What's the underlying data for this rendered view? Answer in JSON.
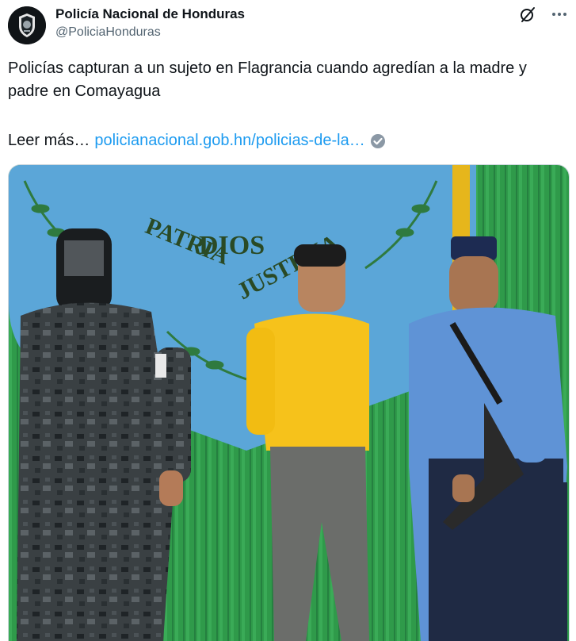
{
  "account": {
    "display_name": "Policía Nacional de Honduras",
    "handle": "@PoliciaHonduras"
  },
  "tweet": {
    "text": "Policías capturan a un sujeto en Flagrancia cuando agredían a la madre y padre en Comayagua",
    "read_more_label": "Leer más…",
    "link_text": "policianacional.gob.hn/policias-de-la…"
  },
  "photo": {
    "wall_text_1": "DIOS",
    "wall_text_2": "PATRIA",
    "wall_text_3": "JUSTICIA"
  },
  "colors": {
    "link": "#1d9bf0",
    "handle": "#536471",
    "verified_check": "#00ba7c",
    "wall_green": "#2f9a4a",
    "wall_blue": "#5ba6d8",
    "shirt_yellow": "#f6c21b",
    "uniform_blue": "#5f93d6"
  },
  "icons": [
    "grok-icon",
    "more-icon",
    "verified-check-icon"
  ]
}
